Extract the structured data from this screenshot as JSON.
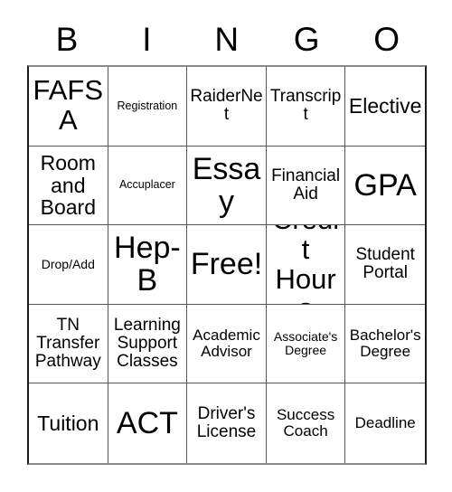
{
  "card": {
    "header_letters": [
      "B",
      "I",
      "N",
      "G",
      "O"
    ],
    "colors": {
      "background": "#ffffff",
      "text": "#000000",
      "grid_line": "#555555",
      "grid_border": "#1a1a1a"
    },
    "rows": [
      [
        {
          "label": "FAFSA",
          "size": "lg"
        },
        {
          "label": "Registration",
          "size": "tiny"
        },
        {
          "label": "RaiderNet",
          "size": "sm"
        },
        {
          "label": "Transcript",
          "size": "sm"
        },
        {
          "label": "Elective",
          "size": "md"
        }
      ],
      [
        {
          "label": "Room and Board",
          "size": "md"
        },
        {
          "label": "Accuplacer",
          "size": "tiny"
        },
        {
          "label": "Essay",
          "size": "xl"
        },
        {
          "label": "Financial Aid",
          "size": "sm"
        },
        {
          "label": "GPA",
          "size": "xl"
        }
      ],
      [
        {
          "label": "Drop/Add",
          "size": "xxs"
        },
        {
          "label": "Hep-B",
          "size": "xl"
        },
        {
          "label": "Free!",
          "size": "xl"
        },
        {
          "label": "Credit Hours",
          "size": "lg"
        },
        {
          "label": "Student Portal",
          "size": "sm"
        }
      ],
      [
        {
          "label": "TN Transfer Pathway",
          "size": "sm"
        },
        {
          "label": "Learning Support Classes",
          "size": "sm"
        },
        {
          "label": "Academic Advisor",
          "size": "xs"
        },
        {
          "label": "Associate's Degree",
          "size": "xxs"
        },
        {
          "label": "Bachelor's Degree",
          "size": "xs"
        }
      ],
      [
        {
          "label": "Tuition",
          "size": "md"
        },
        {
          "label": "ACT",
          "size": "xl"
        },
        {
          "label": "Driver's License",
          "size": "sm"
        },
        {
          "label": "Success Coach",
          "size": "xs"
        },
        {
          "label": "Deadline",
          "size": "xs"
        }
      ]
    ]
  }
}
